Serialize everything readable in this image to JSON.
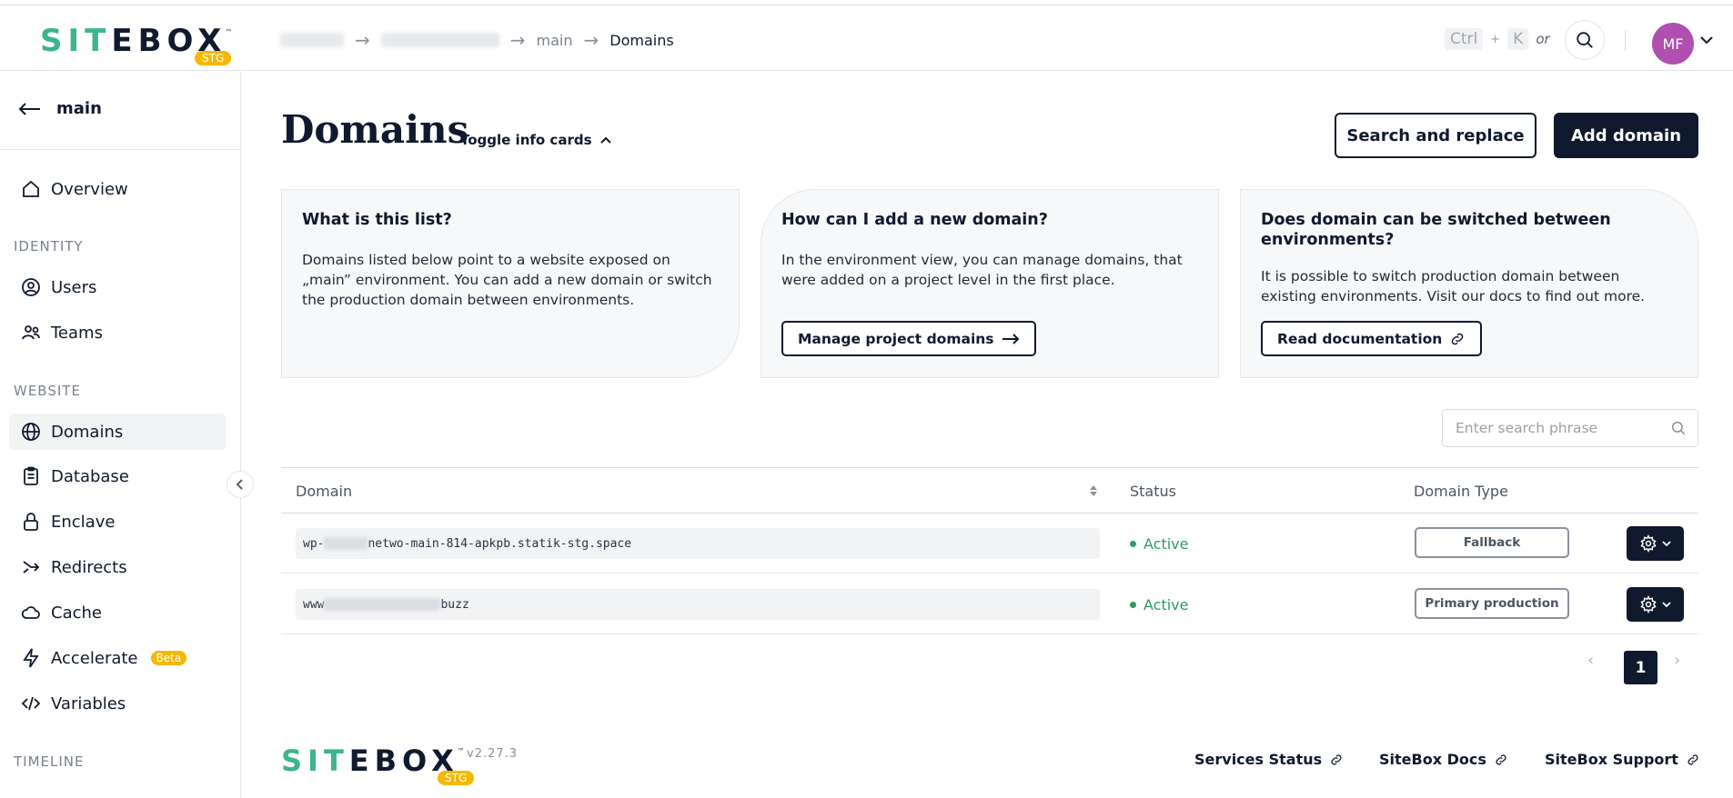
{
  "app": {
    "logo_text_green": "SIT",
    "logo_text_dark": "EBOX",
    "logo_tm": "™",
    "env_badge": "STG"
  },
  "header": {
    "breadcrumbs": [
      "main",
      "Domains"
    ],
    "shortcut_ctrl": "Ctrl",
    "shortcut_plus": "+",
    "shortcut_k": "K",
    "shortcut_or": "or",
    "avatar_initials": "MF"
  },
  "sidebar": {
    "back_label": "main",
    "sections": {
      "identity": "IDENTITY",
      "website": "WEBSITE",
      "timeline": "TIMELINE"
    },
    "items": {
      "overview": "Overview",
      "users": "Users",
      "teams": "Teams",
      "domains": "Domains",
      "database": "Database",
      "enclave": "Enclave",
      "redirects": "Redirects",
      "cache": "Cache",
      "accelerate": "Accelerate",
      "accelerate_badge": "Beta",
      "variables": "Variables"
    }
  },
  "main": {
    "title": "Domains",
    "toggle_label": "Toggle info cards",
    "search_replace_label": "Search and replace",
    "add_domain_label": "Add domain",
    "cards": [
      {
        "title": "What is this list?",
        "body": "Domains listed below point to a website exposed on „main” environment. You can add a new domain or switch the production domain between environments."
      },
      {
        "title": "How can I add a new domain?",
        "body": "In the environment view, you can manage domains, that were added on a project level in the first place.",
        "button": "Manage project domains"
      },
      {
        "title": "Does domain can be switched between environments?",
        "body": "It is possible to switch production domain between existing environments. Visit our docs to find out more.",
        "button": "Read documentation"
      }
    ],
    "search_placeholder": "Enter search phrase",
    "table": {
      "headers": {
        "domain": "Domain",
        "status": "Status",
        "type": "Domain Type"
      },
      "rows": [
        {
          "domain_prefix": "wp-",
          "domain_suffix": "netwo-main-814-apkpb.statik-stg.space",
          "status": "Active",
          "type": "Fallback"
        },
        {
          "domain_prefix": "www",
          "domain_suffix": "buzz",
          "status": "Active",
          "type": "Primary production"
        }
      ]
    },
    "pagination": {
      "current": "1",
      "prev": "‹",
      "next": "›"
    }
  },
  "footer": {
    "version": "v2.27.3",
    "links": [
      "Services Status",
      "SiteBox Docs",
      "SiteBox Support"
    ]
  },
  "colors": {
    "brand_dark": "#0f1a2e",
    "brand_green": "#3fb48a",
    "badge_yellow": "#f5b800",
    "status_green": "#2f9a63",
    "avatar": "#b04fb0"
  }
}
